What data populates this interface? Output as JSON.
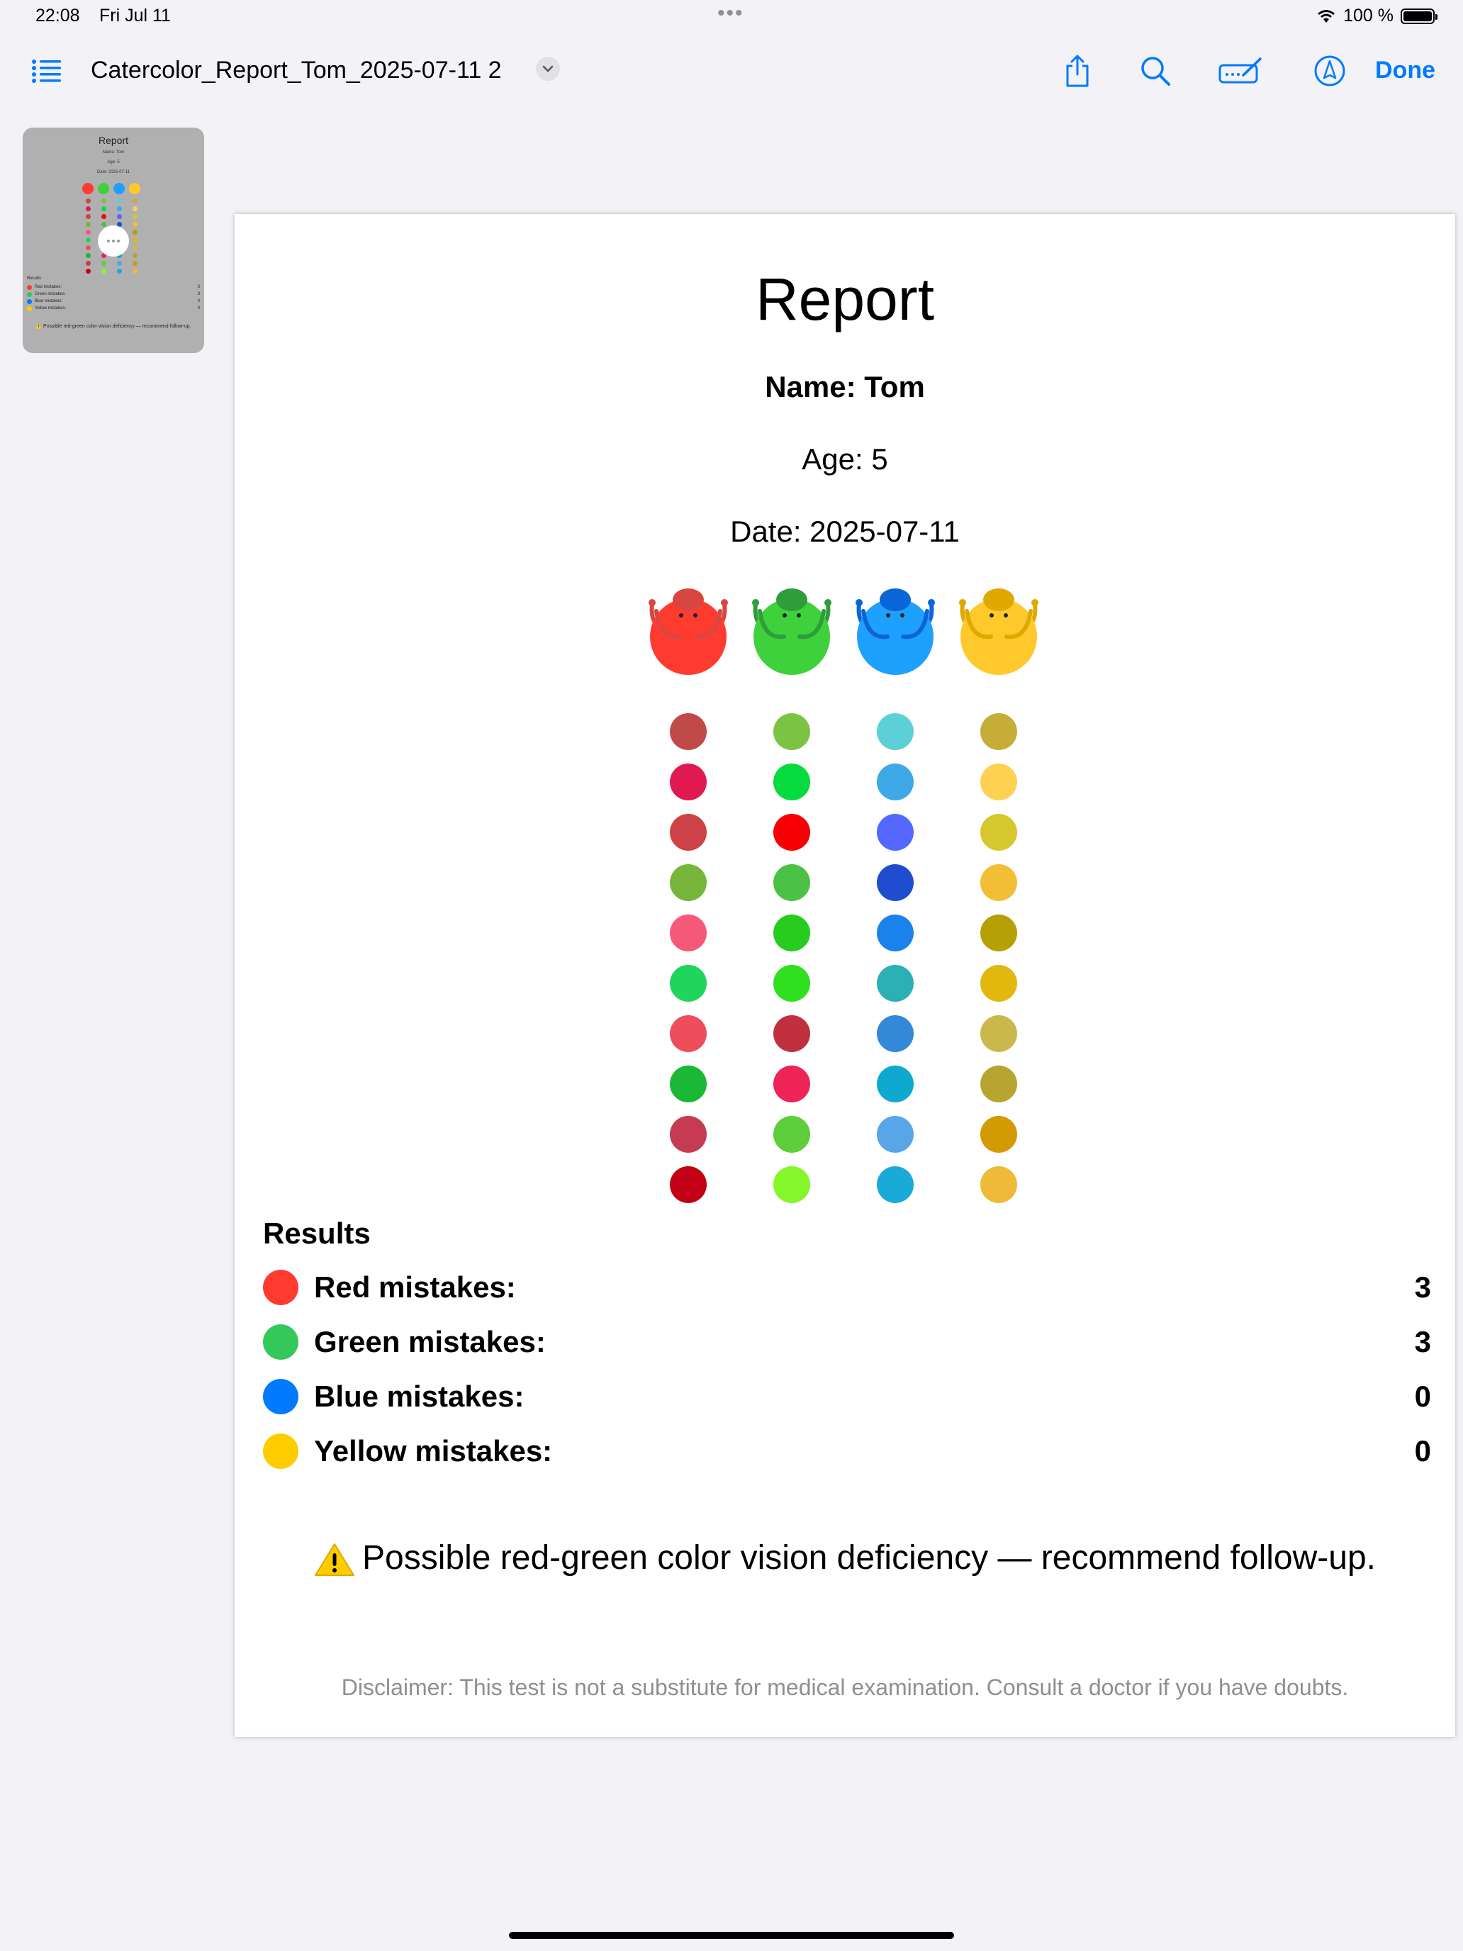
{
  "status_bar": {
    "time": "22:08",
    "date": "Fri Jul 11",
    "battery_label": "100 %"
  },
  "toolbar": {
    "title": "Catercolor_Report_Tom_2025-07-11 2",
    "done_label": "Done",
    "icons": [
      "list-icon",
      "share-icon",
      "search-icon",
      "signature-icon",
      "markup-icon"
    ]
  },
  "thumbnail": {
    "title": "Report",
    "name": "Name: Tom",
    "age": "Age: 5",
    "date": "Date: 2025-07-11",
    "results_heading": "Results",
    "rows": [
      {
        "label": "Red mistakes:",
        "value": "3"
      },
      {
        "label": "Green mistakes:",
        "value": "3"
      },
      {
        "label": "Blue mistakes:",
        "value": "0"
      },
      {
        "label": "Yellow mistakes:",
        "value": "0"
      }
    ],
    "warning": "⚠️ Possible red-green color vision deficiency — recommend follow-up."
  },
  "report": {
    "title": "Report",
    "name": "Name: Tom",
    "age": "Age: 5",
    "date": "Date: 2025-07-11",
    "caterpillars": [
      {
        "color": "#ff3b30",
        "head": "#d8473f",
        "name": "red",
        "dots": [
          "#bf4a47",
          "#e01a51",
          "#cc4247",
          "#76b63a",
          "#f55878",
          "#20d45c",
          "#ee4d5b",
          "#1ab835",
          "#c63b52",
          "#c40016"
        ]
      },
      {
        "color": "#3ed13c",
        "head": "#2e9d3a",
        "name": "green",
        "dots": [
          "#7bc443",
          "#05db3f",
          "#f90005",
          "#4bc245",
          "#27cc1f",
          "#2fe01f",
          "#c1303f",
          "#ee2457",
          "#5ccf3a",
          "#84f72a"
        ]
      },
      {
        "color": "#1ea0ff",
        "head": "#0a65d8",
        "name": "blue",
        "dots": [
          "#5dcfd7",
          "#3ea9e6",
          "#5467ff",
          "#1e4ecf",
          "#1a82eb",
          "#2ab0b5",
          "#3389d8",
          "#0fa9d0",
          "#58a5e8",
          "#1aaad9"
        ]
      },
      {
        "color": "#ffc92c",
        "head": "#e0a800",
        "name": "yellow",
        "dots": [
          "#c6ad38",
          "#ffd152",
          "#d6c72e",
          "#f2be35",
          "#b5a006",
          "#e2b80e",
          "#cbb84d",
          "#b8a431",
          "#d49a04",
          "#efba37"
        ]
      }
    ],
    "results_heading": "Results",
    "results": [
      {
        "label": "Red mistakes:",
        "value": "3",
        "color": "#ff3b30"
      },
      {
        "label": "Green mistakes:",
        "value": "3",
        "color": "#34c759"
      },
      {
        "label": "Blue mistakes:",
        "value": "0",
        "color": "#007aff"
      },
      {
        "label": "Yellow mistakes:",
        "value": "0",
        "color": "#ffcc00"
      }
    ],
    "warning": "Possible red-green color vision deficiency — recommend follow-up.",
    "disclaimer": "Disclaimer: This test is not a substitute for medical examination. Consult a doctor if you have doubts."
  }
}
